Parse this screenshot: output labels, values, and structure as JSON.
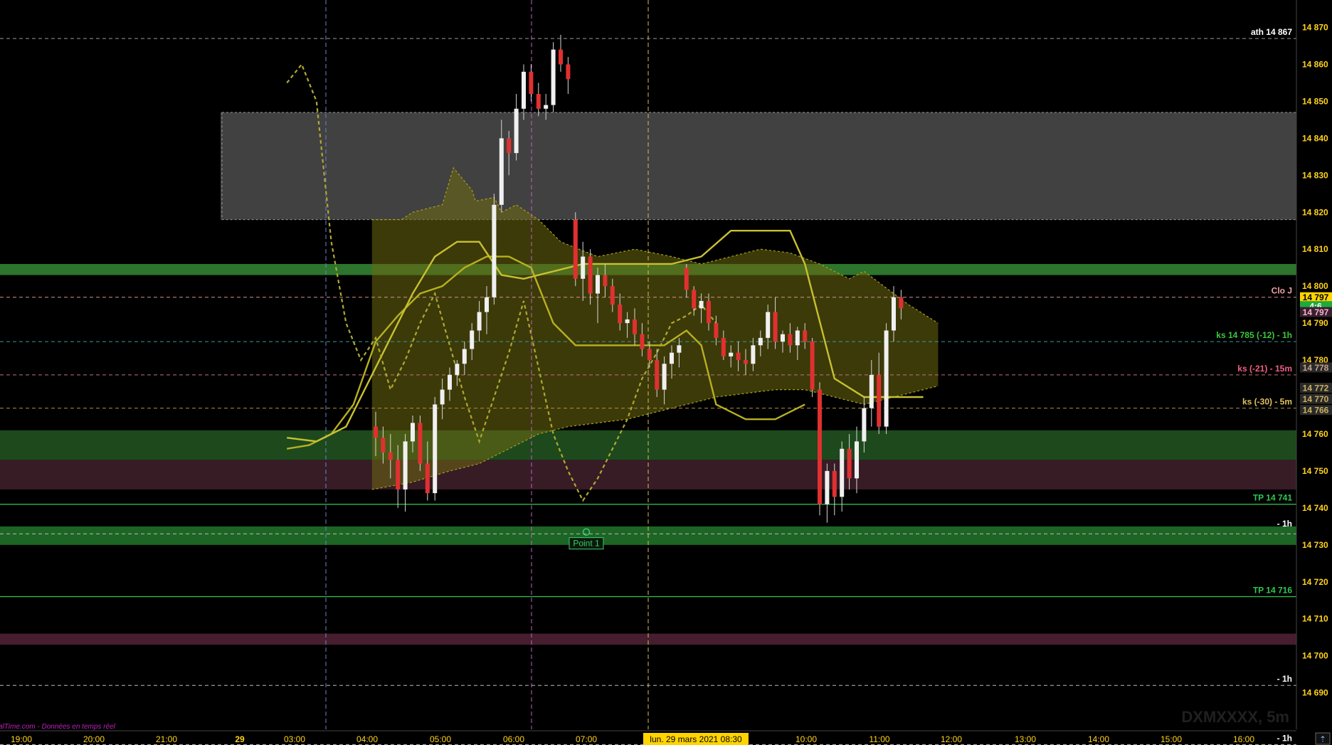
{
  "chart_data": {
    "type": "candlestick",
    "symbol_watermark": "DXMXXXX, 5m",
    "source_text": "alTime.com - Données en temps réel",
    "y_axis": {
      "min": 14682,
      "max": 14872,
      "ticks": [
        "14 870",
        "14 860",
        "14 850",
        "14 840",
        "14 830",
        "14 820",
        "14 810",
        "14 800",
        "14 790",
        "14 780",
        "14 770",
        "14 760",
        "14 750",
        "14 740",
        "14 730",
        "14 720",
        "14 710",
        "14 700",
        "14 690"
      ],
      "tick_values": [
        14870,
        14860,
        14850,
        14840,
        14830,
        14820,
        14810,
        14800,
        14790,
        14780,
        14770,
        14760,
        14750,
        14740,
        14730,
        14720,
        14710,
        14700,
        14690
      ]
    },
    "x_axis": {
      "labels": [
        "19:00",
        "20:00",
        "21:00",
        "29",
        "03:00",
        "04:00",
        "05:00",
        "06:00",
        "07:00",
        "10:00",
        "11:00",
        "12:00",
        "13:00",
        "14:00",
        "15:00",
        "16:00"
      ],
      "cursor_label": "lun. 29 mars 2021 08:30"
    },
    "price_badges": [
      {
        "text": "14 797",
        "value": 14797,
        "bg": "#ffd400",
        "fg": "#000000"
      },
      {
        "text": "4:6",
        "value": 14794.6,
        "bg": "#1faa3c",
        "fg": "#ffffff"
      },
      {
        "text": "14 797",
        "value": 14793,
        "bg": "#3a2030",
        "fg": "#f3b3c8"
      },
      {
        "text": "14 778",
        "value": 14778,
        "bg": "#2a2a2a",
        "fg": "#c8a08a"
      },
      {
        "text": "14 772",
        "value": 14772.5,
        "bg": "#2a2a2a",
        "fg": "#c8b060"
      },
      {
        "text": "14 770",
        "value": 14769.5,
        "bg": "#2a2a2a",
        "fg": "#c8b060"
      },
      {
        "text": "14 766",
        "value": 14766.5,
        "bg": "#2a2a2a",
        "fg": "#c8b060"
      }
    ],
    "levels": [
      {
        "label": "ath 14 867",
        "value": 14867,
        "color": "#9a9a9a",
        "style": "dash",
        "text_color": "#ffffff"
      },
      {
        "label": "Clo J",
        "value": 14797,
        "color": "#d89090",
        "style": "dash",
        "text_color": "#f0a0a0"
      },
      {
        "label": "ks 14 785 (-12) - 1h",
        "value": 14785,
        "color": "#3a9a9a",
        "style": "dash",
        "text_color": "#3cc83c"
      },
      {
        "label": "ks (-21) - 15m",
        "value": 14776,
        "color": "#c07080",
        "style": "dash",
        "text_color": "#f06080"
      },
      {
        "label": "ks (-30) - 5m",
        "value": 14767,
        "color": "#b09040",
        "style": "dash",
        "text_color": "#e0c060"
      },
      {
        "label": "TP 14 741",
        "value": 14741,
        "color": "#2ec850",
        "style": "solid",
        "text_color": "#2ec850"
      },
      {
        "label": "- 1h",
        "value": 14734,
        "color": "#2ec850",
        "style": "none",
        "text_color": "#ffffff"
      },
      {
        "label": "",
        "value": 14733,
        "color": "#bbbbbb",
        "style": "dash",
        "text_color": "#ffffff"
      },
      {
        "label": "TP 14 716",
        "value": 14716,
        "color": "#2ec850",
        "style": "solid",
        "text_color": "#2ec850"
      },
      {
        "label": "- 1h",
        "value": 14692,
        "color": "#bbbbbb",
        "style": "dash",
        "text_color": "#ffffff"
      },
      {
        "label": "- 1h",
        "value": 14676,
        "color": "#bbbbbb",
        "style": "dash",
        "text_color": "#ffffff"
      }
    ],
    "zones": [
      {
        "from": 14818,
        "to": 14847,
        "color": "#454545"
      },
      {
        "from": 14803,
        "to": 14806,
        "color": "#2f7a2f"
      },
      {
        "from": 14753,
        "to": 14761,
        "color": "#1f4d1f"
      },
      {
        "from": 14745,
        "to": 14753,
        "color": "#3a1e28"
      },
      {
        "from": 14730,
        "to": 14735,
        "color": "#1f6a26"
      },
      {
        "from": 14703,
        "to": 14706,
        "color": "#4a2030"
      }
    ],
    "annotation": {
      "label": "Point 1",
      "value": 14733.5
    },
    "candles": [
      [
        14762,
        14766,
        14754,
        14759
      ],
      [
        14759,
        14762,
        14752,
        14755
      ],
      [
        14755,
        14760,
        14748,
        14753
      ],
      [
        14753,
        14757,
        14740,
        14745
      ],
      [
        14745,
        14760,
        14739,
        14758
      ],
      [
        14758,
        14765,
        14755,
        14763
      ],
      [
        14763,
        14765,
        14750,
        14752
      ],
      [
        14752,
        14758,
        14742,
        14744
      ],
      [
        14744,
        14770,
        14742,
        14768
      ],
      [
        14768,
        14775,
        14764,
        14772
      ],
      [
        14772,
        14778,
        14769,
        14776
      ],
      [
        14776,
        14780,
        14773,
        14779
      ],
      [
        14779,
        14785,
        14776,
        14783
      ],
      [
        14783,
        14790,
        14780,
        14788
      ],
      [
        14788,
        14796,
        14785,
        14793
      ],
      [
        14793,
        14800,
        14787,
        14797
      ],
      [
        14797,
        14825,
        14795,
        14822
      ],
      [
        14822,
        14845,
        14820,
        14840
      ],
      [
        14840,
        14842,
        14830,
        14836
      ],
      [
        14836,
        14852,
        14834,
        14848
      ],
      [
        14848,
        14860,
        14845,
        14858
      ],
      [
        14858,
        14860,
        14850,
        14852
      ],
      [
        14852,
        14855,
        14846,
        14848
      ],
      [
        14848,
        14852,
        14845,
        14849
      ],
      [
        14849,
        14866,
        14847,
        14864
      ],
      [
        14864,
        14868,
        14858,
        14860
      ],
      [
        14860,
        14862,
        14852,
        14856
      ],
      [
        14818,
        14820,
        14800,
        14802
      ],
      [
        14802,
        14812,
        14796,
        14808
      ],
      [
        14808,
        14810,
        14795,
        14798
      ],
      [
        14798,
        14805,
        14790,
        14803
      ],
      [
        14803,
        14806,
        14797,
        14800
      ],
      [
        14800,
        14802,
        14793,
        14795
      ],
      [
        14795,
        14798,
        14788,
        14790
      ],
      [
        14790,
        14793,
        14786,
        14791
      ],
      [
        14791,
        14794,
        14784,
        14787
      ],
      [
        14787,
        14790,
        14781,
        14783
      ],
      [
        14783,
        14785,
        14778,
        14780
      ],
      [
        14780,
        14783,
        14770,
        14772
      ],
      [
        14772,
        14781,
        14768,
        14779
      ],
      [
        14779,
        14784,
        14775,
        14782
      ],
      [
        14782,
        14786,
        14778,
        14784
      ],
      [
        14805,
        14806,
        14797,
        14799
      ],
      [
        14799,
        14800,
        14792,
        14794
      ],
      [
        14794,
        14798,
        14790,
        14796
      ],
      [
        14796,
        14798,
        14788,
        14790
      ],
      [
        14790,
        14792,
        14784,
        14786
      ],
      [
        14786,
        14788,
        14780,
        14781
      ],
      [
        14781,
        14784,
        14778,
        14782
      ],
      [
        14782,
        14785,
        14777,
        14780
      ],
      [
        14780,
        14783,
        14776,
        14779
      ],
      [
        14779,
        14786,
        14777,
        14784
      ],
      [
        14784,
        14788,
        14781,
        14786
      ],
      [
        14786,
        14795,
        14783,
        14793
      ],
      [
        14793,
        14797,
        14783,
        14785
      ],
      [
        14785,
        14788,
        14782,
        14787
      ],
      [
        14787,
        14790,
        14782,
        14784
      ],
      [
        14784,
        14789,
        14780,
        14788
      ],
      [
        14788,
        14790,
        14783,
        14785
      ],
      [
        14785,
        14786,
        14770,
        14772
      ],
      [
        14772,
        14774,
        14738,
        14741
      ],
      [
        14741,
        14752,
        14736,
        14750
      ],
      [
        14750,
        14752,
        14738,
        14743
      ],
      [
        14743,
        14758,
        14739,
        14756
      ],
      [
        14756,
        14760,
        14745,
        14748
      ],
      [
        14748,
        14762,
        14744,
        14758
      ],
      [
        14758,
        14770,
        14755,
        14767
      ],
      [
        14767,
        14780,
        14762,
        14776
      ],
      [
        14776,
        14782,
        14760,
        14762
      ],
      [
        14762,
        14790,
        14760,
        14788
      ],
      [
        14788,
        14800,
        14785,
        14797
      ],
      [
        14797,
        14799,
        14791,
        14794
      ]
    ],
    "band_upper": [
      [
        -0.5,
        14818
      ],
      [
        3.5,
        14818
      ],
      [
        5,
        14820
      ],
      [
        9,
        14822
      ],
      [
        10.5,
        14832
      ],
      [
        13,
        14826
      ],
      [
        13.5,
        14823
      ],
      [
        16,
        14824
      ],
      [
        17,
        14820
      ],
      [
        19,
        14822
      ],
      [
        22,
        14818
      ],
      [
        25,
        14812
      ],
      [
        30,
        14808
      ],
      [
        35,
        14810
      ],
      [
        40,
        14808
      ],
      [
        44,
        14806
      ],
      [
        48,
        14808
      ],
      [
        52,
        14810
      ],
      [
        56,
        14809
      ],
      [
        60,
        14806
      ],
      [
        64,
        14802
      ],
      [
        66,
        14804
      ],
      [
        68,
        14801
      ],
      [
        72,
        14795
      ],
      [
        76,
        14790
      ]
    ],
    "band_lower": [
      [
        -0.5,
        14745
      ],
      [
        5,
        14747
      ],
      [
        10,
        14750
      ],
      [
        14,
        14752
      ],
      [
        18,
        14756
      ],
      [
        22,
        14760
      ],
      [
        26,
        14762
      ],
      [
        30,
        14763
      ],
      [
        34,
        14764
      ],
      [
        38,
        14766
      ],
      [
        42,
        14768
      ],
      [
        46,
        14770
      ],
      [
        50,
        14771
      ],
      [
        54,
        14772
      ],
      [
        58,
        14772
      ],
      [
        62,
        14770
      ],
      [
        66,
        14768
      ],
      [
        70,
        14770
      ],
      [
        74,
        14772
      ],
      [
        76,
        14773
      ]
    ],
    "line_solid_1": [
      [
        -12,
        14756
      ],
      [
        -9,
        14757
      ],
      [
        -6,
        14760
      ],
      [
        -3,
        14768
      ],
      [
        0,
        14785
      ],
      [
        3,
        14792
      ],
      [
        6,
        14798
      ],
      [
        9,
        14800
      ],
      [
        12,
        14805
      ],
      [
        15,
        14808
      ],
      [
        18,
        14808
      ],
      [
        21,
        14805
      ],
      [
        24,
        14790
      ],
      [
        27,
        14784
      ],
      [
        30,
        14784
      ],
      [
        33,
        14784
      ],
      [
        36,
        14784
      ],
      [
        39,
        14784
      ],
      [
        42,
        14788
      ],
      [
        44,
        14784
      ],
      [
        46,
        14768
      ],
      [
        50,
        14764
      ],
      [
        54,
        14764
      ],
      [
        58,
        14768
      ]
    ],
    "line_solid_2": [
      [
        -12,
        14759
      ],
      [
        -8,
        14758
      ],
      [
        -4,
        14762
      ],
      [
        0,
        14778
      ],
      [
        5,
        14798
      ],
      [
        8,
        14808
      ],
      [
        11,
        14812
      ],
      [
        14,
        14812
      ],
      [
        17,
        14803
      ],
      [
        20,
        14802
      ],
      [
        24,
        14804
      ],
      [
        28,
        14806
      ],
      [
        32,
        14806
      ],
      [
        36,
        14806
      ],
      [
        40,
        14806
      ],
      [
        44,
        14808
      ],
      [
        48,
        14815
      ],
      [
        52,
        14815
      ],
      [
        56,
        14815
      ],
      [
        58,
        14806
      ],
      [
        62,
        14775
      ],
      [
        66,
        14770
      ],
      [
        70,
        14770
      ],
      [
        74,
        14770
      ]
    ],
    "line_dotted": [
      [
        -12,
        14855
      ],
      [
        -10,
        14860
      ],
      [
        -8,
        14850
      ],
      [
        -6,
        14812
      ],
      [
        -4,
        14790
      ],
      [
        -2,
        14780
      ],
      [
        0,
        14786
      ],
      [
        2,
        14772
      ],
      [
        4,
        14780
      ],
      [
        6,
        14790
      ],
      [
        8,
        14798
      ],
      [
        10,
        14784
      ],
      [
        12,
        14770
      ],
      [
        14,
        14758
      ],
      [
        16,
        14770
      ],
      [
        18,
        14782
      ],
      [
        20,
        14796
      ],
      [
        22,
        14778
      ],
      [
        24,
        14760
      ],
      [
        26,
        14750
      ],
      [
        28,
        14742
      ],
      [
        30,
        14748
      ],
      [
        32,
        14756
      ],
      [
        34,
        14764
      ],
      [
        36,
        14775
      ],
      [
        38,
        14782
      ],
      [
        40,
        14790
      ],
      [
        42,
        14792
      ],
      [
        44,
        14795
      ],
      [
        46,
        14790
      ]
    ]
  }
}
